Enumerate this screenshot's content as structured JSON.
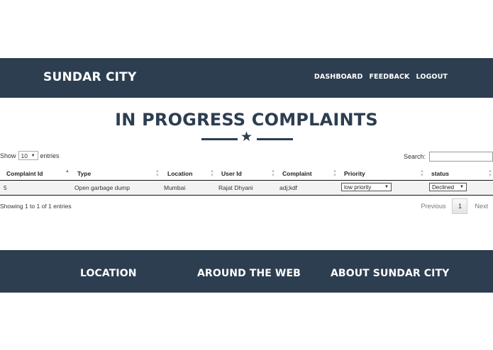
{
  "navbar": {
    "brand": "SUNDAR CITY",
    "links": [
      "DASHBOARD",
      "FEEDBACK",
      "LOGOUT"
    ]
  },
  "main": {
    "title": "IN PROGRESS COMPLAINTS",
    "show_label": "Show",
    "entries_label": "entries",
    "page_length": "10",
    "search_label": "Search:",
    "search_value": "",
    "table": {
      "columns": [
        "Complaint Id",
        "Type",
        "Location",
        "User Id",
        "Complaint",
        "Priority",
        "status"
      ],
      "sorted_column": "Complaint Id",
      "rows": [
        {
          "id": "5",
          "type": "Open garbage dump",
          "location": "Mumbai",
          "user_id": "Rajat Dhyani",
          "complaint": "adj;kdf",
          "priority": "low priority",
          "status": "Declined"
        }
      ]
    },
    "info": "Showing 1 to 1 of 1 entries",
    "paging": {
      "previous": "Previous",
      "current_page": "1",
      "next": "Next"
    }
  },
  "footer": {
    "columns": [
      "LOCATION",
      "AROUND THE WEB",
      "ABOUT SUNDAR CITY"
    ]
  },
  "colors": {
    "primary": "#2c3e50",
    "sort_active": "#5a6ad6",
    "row_background": "#f3f3f3"
  },
  "icons": {
    "divider": "star-icon",
    "select_caret": "caret-down-icon",
    "sort": "sort-both-icon",
    "sort_active": "sort-asc-icon"
  }
}
